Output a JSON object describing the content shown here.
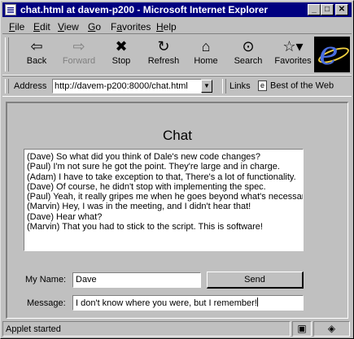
{
  "window": {
    "title": "chat.html at davem-p200 - Microsoft Internet Explorer",
    "controls": {
      "minimize": "_",
      "maximize": "□",
      "close": "✕"
    }
  },
  "menu": [
    {
      "label": "File",
      "accel": "F",
      "rest": "ile"
    },
    {
      "label": "Edit",
      "accel": "E",
      "rest": "dit"
    },
    {
      "label": "View",
      "accel": "V",
      "rest": "iew"
    },
    {
      "label": "Go",
      "accel": "G",
      "rest": "o"
    },
    {
      "label": "Favorites",
      "accel": "a",
      "pre": "F",
      "rest": "vorites"
    },
    {
      "label": "Help",
      "accel": "H",
      "rest": "elp"
    }
  ],
  "toolbar": {
    "back": {
      "label": "Back",
      "icon": "⇦"
    },
    "forward": {
      "label": "Forward",
      "icon": "⇨"
    },
    "stop": {
      "label": "Stop",
      "icon": "✖"
    },
    "refresh": {
      "label": "Refresh",
      "icon": "↻"
    },
    "home": {
      "label": "Home",
      "icon": "⌂"
    },
    "search": {
      "label": "Search",
      "icon": "⊙"
    },
    "favorites": {
      "label": "Favorites",
      "icon": "☆▾"
    }
  },
  "address": {
    "label": "Address",
    "url": "http://davem-p200:8000/chat.html",
    "links_label": "Links",
    "links_item": "Best of the Web"
  },
  "chat": {
    "title": "Chat",
    "messages": [
      "(Dave) So what did you think of Dale's new code changes?",
      "(Paul) I'm not sure he got the point. They're large and in charge.",
      "(Adam) I have to take exception to that, There's a lot of functionality.",
      "(Dave) Of course, he didn't stop with implementing the spec.",
      "(Paul) Yeah, it really gripes me when he goes beyond what's necessar",
      "(Marvin) Hey, I was in the meeting, and I didn't hear that!",
      "(Dave) Hear what?",
      "(Marvin) That you had to stick to the script. This is software!"
    ],
    "name_label": "My Name:",
    "name_value": "Dave",
    "send_label": "Send",
    "message_label": "Message:",
    "message_value": "I don't know where you were, but I remember!"
  },
  "status": {
    "text": "Applet started"
  }
}
